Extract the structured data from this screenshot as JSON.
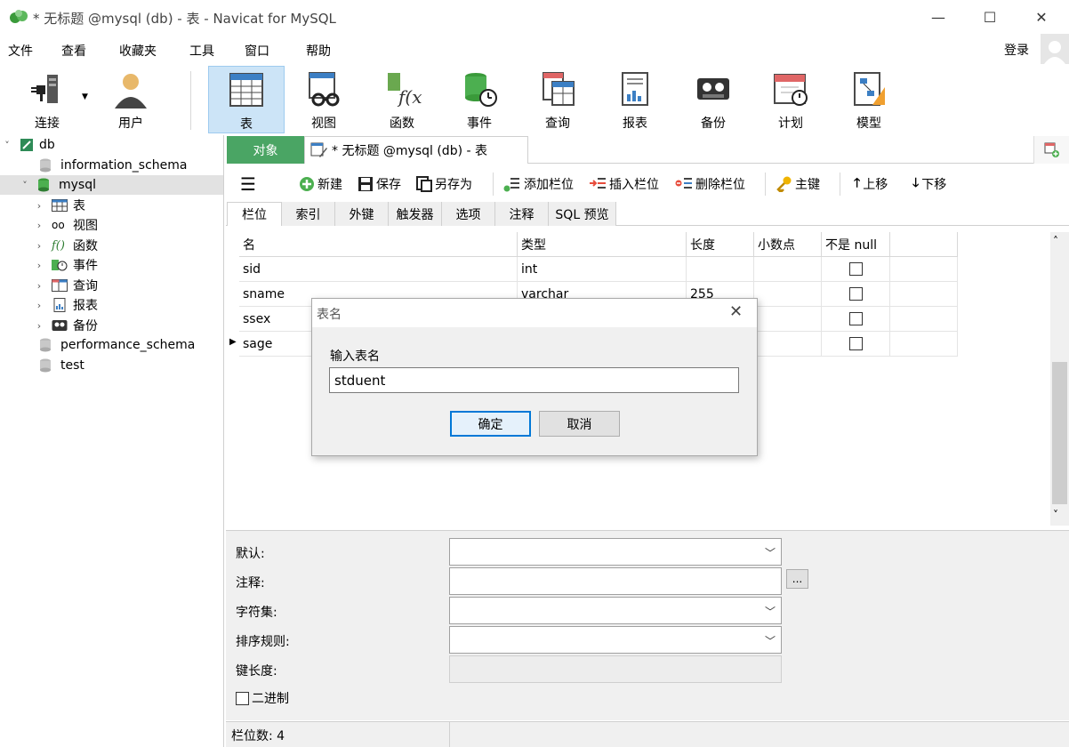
{
  "window": {
    "title": "* 无标题 @mysql (db) - 表 - Navicat for MySQL",
    "minimize": "—",
    "maximize": "☐",
    "close": "✕"
  },
  "menu": {
    "items": [
      "文件",
      "查看",
      "收藏夹",
      "工具",
      "窗口",
      "帮助"
    ],
    "login": "登录"
  },
  "toolbar": {
    "items": [
      {
        "label": "连接",
        "icon": "connection-icon"
      },
      {
        "label": "用户",
        "icon": "user-icon"
      },
      {
        "label": "表",
        "icon": "table-icon",
        "active": true
      },
      {
        "label": "视图",
        "icon": "view-icon"
      },
      {
        "label": "函数",
        "icon": "function-icon"
      },
      {
        "label": "事件",
        "icon": "event-icon"
      },
      {
        "label": "查询",
        "icon": "query-icon"
      },
      {
        "label": "报表",
        "icon": "report-icon"
      },
      {
        "label": "备份",
        "icon": "backup-icon"
      },
      {
        "label": "计划",
        "icon": "schedule-icon"
      },
      {
        "label": "模型",
        "icon": "model-icon"
      }
    ]
  },
  "sidebar": {
    "connection": "db",
    "databases": [
      {
        "name": "information_schema"
      },
      {
        "name": "mysql",
        "selected": true
      },
      {
        "name": "performance_schema"
      },
      {
        "name": "test"
      }
    ],
    "children": [
      "表",
      "视图",
      "函数",
      "事件",
      "查询",
      "报表",
      "备份"
    ]
  },
  "tabs": {
    "objects": "对象",
    "document": "* 无标题 @mysql (db) - 表"
  },
  "subtoolbar": {
    "new": "新建",
    "save": "保存",
    "save_as": "另存为",
    "add_field": "添加栏位",
    "insert_field": "插入栏位",
    "delete_field": "删除栏位",
    "primary_key": "主键",
    "move_up": "上移",
    "move_down": "下移"
  },
  "field_tabs": [
    "栏位",
    "索引",
    "外键",
    "触发器",
    "选项",
    "注释",
    "SQL 预览"
  ],
  "grid": {
    "columns": [
      "名",
      "类型",
      "长度",
      "小数点",
      "不是 null"
    ],
    "rows": [
      {
        "name": "sid",
        "type": "int",
        "length": "",
        "decimals": "",
        "not_null": false
      },
      {
        "name": "sname",
        "type": "varchar",
        "length": "255",
        "decimals": "",
        "not_null": false
      },
      {
        "name": "ssex",
        "type": "",
        "length": "",
        "decimals": "",
        "not_null": false
      },
      {
        "name": "sage",
        "type": "",
        "length": "",
        "decimals": "",
        "not_null": false
      }
    ]
  },
  "properties": {
    "default_label": "默认:",
    "comment_label": "注释:",
    "charset_label": "字符集:",
    "collation_label": "排序规则:",
    "key_length_label": "键长度:",
    "binary_label": "二进制",
    "dots": "..."
  },
  "status": {
    "field_count": "栏位数: 4"
  },
  "dialog": {
    "title": "表名",
    "prompt": "输入表名",
    "value": "stduent",
    "ok": "确定",
    "cancel": "取消"
  }
}
